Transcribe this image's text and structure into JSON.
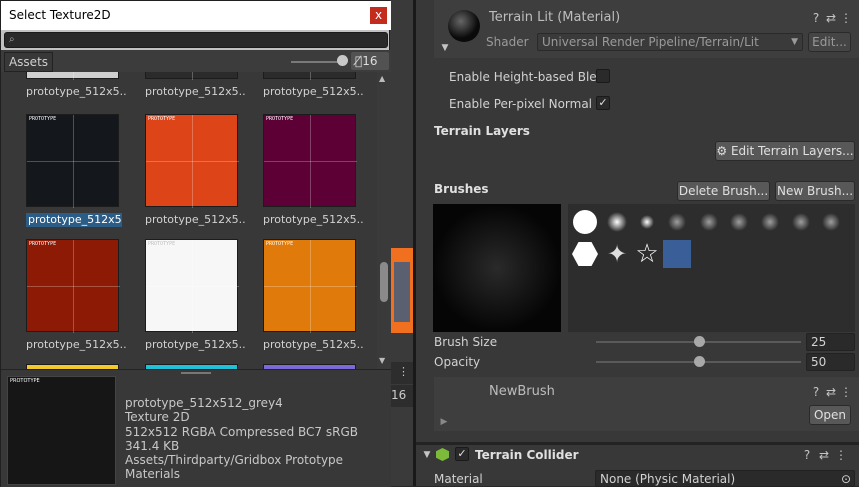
{
  "picker": {
    "title": "Select Texture2D",
    "close_glyph": "x",
    "search_placeholder": "",
    "tab_label": "Assets",
    "visible_count": "16",
    "items": [
      {
        "name": "prototype_512x5...",
        "color": "#cfcfcf"
      },
      {
        "name": "prototype_512x5...",
        "color": "#2b2b2b"
      },
      {
        "name": "prototype_512x5...",
        "color": "#2b2b2b"
      },
      {
        "name": "prototype_512x5...",
        "color": "#14171c"
      },
      {
        "name": "prototype_512x5...",
        "color": "#dd4418"
      },
      {
        "name": "prototype_512x5...",
        "color": "#5c0036"
      },
      {
        "name": "prototype_512x5...",
        "color": "#8c1a05"
      },
      {
        "name": "prototype_512x5...",
        "color": "#f7f7f7"
      },
      {
        "name": "prototype_512x5...",
        "color": "#e07a0a"
      }
    ],
    "selected_index": 3,
    "preview": {
      "name": "prototype_512x512_grey4",
      "type": "Texture 2D",
      "format": "512x512  RGBA Compressed BC7 sRGB",
      "size": "341.4 KB",
      "path": "Assets/Thirdparty/Gridbox Prototype Materials"
    }
  },
  "scene": {
    "count_fragment": "16"
  },
  "inspector": {
    "material_title": "Terrain Lit (Material)",
    "shader_label": "Shader",
    "shader_value": "Universal Render Pipeline/Terrain/Lit",
    "edit_button": "Edit...",
    "height_blend_label": "Enable Height-based Blen",
    "height_blend_checked": false,
    "per_pixel_label": "Enable Per-pixel Normal",
    "per_pixel_checked": true,
    "terrain_layers_header": "Terrain Layers",
    "edit_layers_button": "Edit Terrain Layers...",
    "brushes_header": "Brushes",
    "delete_brush_button": "Delete Brush...",
    "new_brush_button": "New Brush...",
    "brush_size_label": "Brush Size",
    "brush_size_value": "25",
    "brush_size_level": 0.5,
    "opacity_label": "Opacity",
    "opacity_value": "50",
    "opacity_level": 0.5,
    "newbrush_title": "NewBrush",
    "open_button": "Open",
    "collider_title": "Terrain Collider",
    "material_label": "Material",
    "material_value": "None (Physic Material)"
  }
}
